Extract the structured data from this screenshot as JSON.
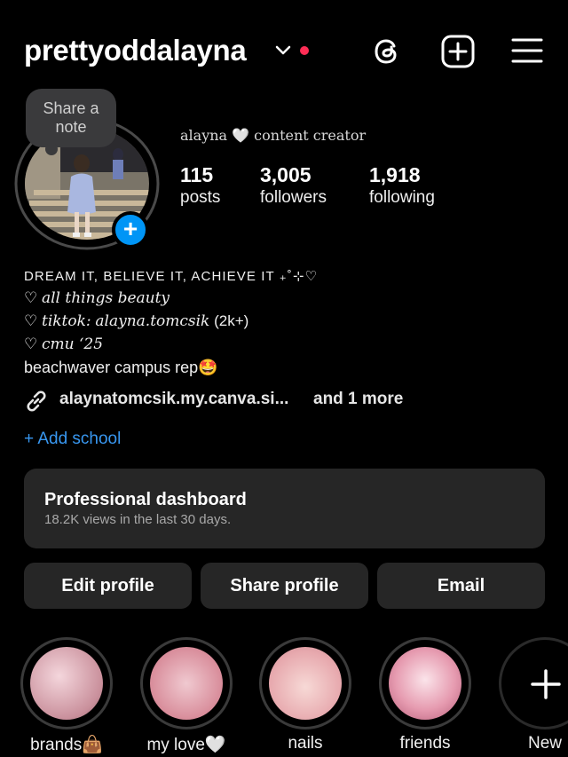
{
  "header": {
    "username": "prettyoddalayna",
    "icons": [
      "chevron-down-icon",
      "notification-dot",
      "threads-icon",
      "create-post-icon",
      "menu-icon"
    ]
  },
  "profile": {
    "note_label": "Share a note",
    "display_name": "alayna 🤍 content creator",
    "stats": [
      {
        "value": "115",
        "label": "posts"
      },
      {
        "value": "3,005",
        "label": "followers"
      },
      {
        "value": "1,918",
        "label": "following"
      }
    ]
  },
  "bio": {
    "line1": "DREAM IT, BELIEVE IT, ACHIEVE IT ₊˚⊹♡",
    "line2_heart": "♡",
    "line2": "all things beauty",
    "line3_heart": "♡",
    "line3_prefix": "tiktok:",
    "line3_handle": "alayna.tomcsik",
    "line3_suffix": "(2k+)",
    "line4_heart": "♡",
    "line4": "cmu ‘25",
    "line5": "beachwaver campus rep🤩",
    "link_text": "alaynatomcsik.my.canva.si...",
    "link_more": "and 1 more",
    "add_school": "+ Add school"
  },
  "dashboard": {
    "title": "Professional dashboard",
    "subtitle": "18.2K views in the last 30 days."
  },
  "buttons": {
    "edit": "Edit profile",
    "share": "Share profile",
    "email": "Email"
  },
  "highlights": [
    {
      "label": "brands👜"
    },
    {
      "label": "my love🤍"
    },
    {
      "label": "nails"
    },
    {
      "label": "friends"
    },
    {
      "label": "New"
    }
  ],
  "colors": {
    "accent": "#0095f6",
    "link": "#3897f0",
    "dot": "#ff2d55",
    "card": "#262626"
  }
}
